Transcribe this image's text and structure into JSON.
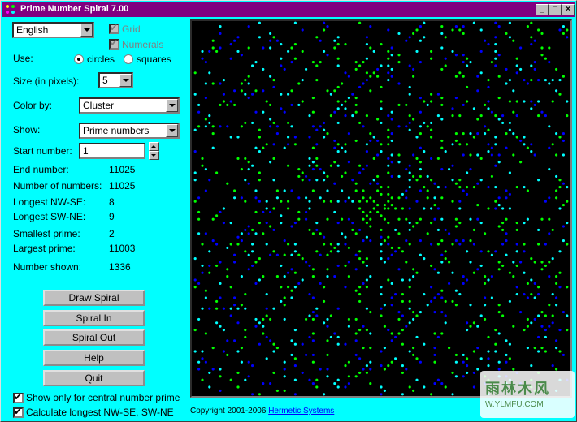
{
  "window": {
    "title": "Prime Number Spiral 7.00"
  },
  "titlebar_buttons": {
    "minimize": "_",
    "maximize": "□",
    "close": "×"
  },
  "language": {
    "selected": "English"
  },
  "grid_checkbox": {
    "label": "Grid",
    "checked": true,
    "enabled": false
  },
  "numerals_checkbox": {
    "label": "Numerals",
    "checked": true,
    "enabled": false
  },
  "use": {
    "label": "Use:",
    "options": [
      "circles",
      "squares"
    ],
    "selected": "circles"
  },
  "size": {
    "label": "Size (in pixels):",
    "value": "5"
  },
  "color_by": {
    "label": "Color by:",
    "value": "Cluster"
  },
  "show": {
    "label": "Show:",
    "value": "Prime numbers"
  },
  "start_number": {
    "label": "Start number:",
    "value": "1"
  },
  "stats": [
    {
      "label": "End number:",
      "value": "11025"
    },
    {
      "label": "Number of numbers:",
      "value": "11025"
    },
    {
      "label": "Longest NW-SE:",
      "value": "8"
    },
    {
      "label": "Longest SW-NE:",
      "value": "9"
    },
    {
      "label": "Smallest prime:",
      "value": "2"
    },
    {
      "label": "Largest prime:",
      "value": "11003"
    },
    {
      "label": "Number shown:",
      "value": "1336"
    }
  ],
  "buttons": [
    "Draw Spiral",
    "Spiral In",
    "Spiral Out",
    "Help",
    "Quit"
  ],
  "options": [
    {
      "label": "Show only for central number prime",
      "checked": true
    },
    {
      "label": "Calculate longest NW-SE, SW-NE",
      "checked": true
    }
  ],
  "copyright": {
    "text": "Copyright 2001-2006",
    "link": "Hermetic Systems"
  },
  "watermark": {
    "text": "雨林木风",
    "url": "W.YLMFU.COM"
  },
  "spiral": {
    "colors": [
      "#ffff00",
      "#00ffff",
      "#ff00ff",
      "#00ff00",
      "#ff0000",
      "#0000ff"
    ],
    "central_color": "#00ff00"
  }
}
